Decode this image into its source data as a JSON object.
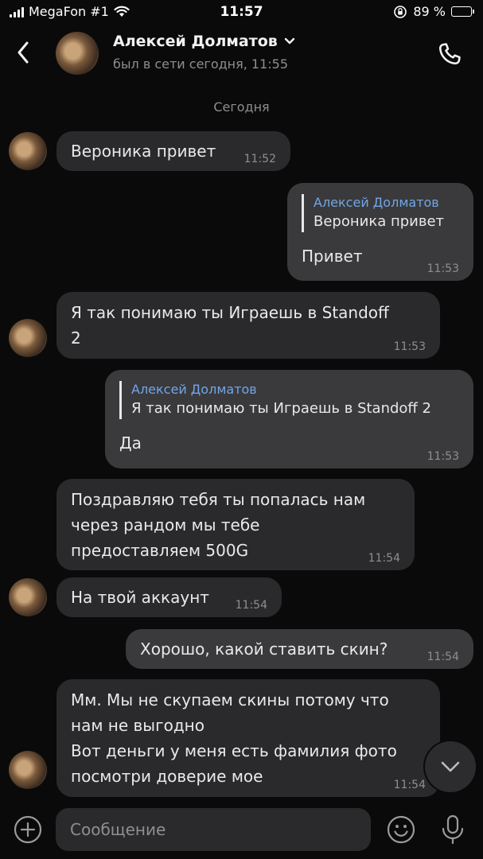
{
  "status_bar": {
    "carrier": "MegaFon #1",
    "time": "11:57",
    "battery": "89 %",
    "battery_level": 0.89
  },
  "header": {
    "contact_name": "Алексей Долматов",
    "last_seen": "был в сети сегодня, 11:55"
  },
  "date_separator": "Сегодня",
  "messages": [
    {
      "direction": "in",
      "text": "Вероника привет",
      "time": "11:52"
    },
    {
      "direction": "out",
      "reply_author": "Алексей Долматов",
      "reply_text": "Вероника привет",
      "text": "Привет",
      "time": "11:53"
    },
    {
      "direction": "in",
      "text": "Я так понимаю ты Играешь в Standoff\n2",
      "time": "11:53"
    },
    {
      "direction": "out",
      "reply_author": "Алексей Долматов",
      "reply_text": "Я так понимаю ты Играешь в Standoff 2",
      "text": "Да",
      "time": "11:53"
    },
    {
      "direction": "in",
      "text": "Поздравляю тебя ты попалась нам\nчерез рандом мы тебе\nпредоставляем 500G",
      "time": "11:54"
    },
    {
      "direction": "in",
      "text": "На твой аккаунт",
      "time": "11:54"
    },
    {
      "direction": "out",
      "text": "Хорошо, какой ставить скин?",
      "time": "11:54"
    },
    {
      "direction": "in",
      "text": "Мм. Мы не скупаем скины потому что\nнам не выгодно\nВот деньги у меня есть фамилия фото\nпосмотри доверие мое",
      "time": "11:54"
    }
  ],
  "composer": {
    "placeholder": "Сообщение"
  },
  "icons": {
    "back": "chevron-left-icon",
    "dropdown": "chevron-down-icon",
    "call": "phone-icon",
    "scroll_down": "chevron-down-icon",
    "attach": "plus-circle-icon",
    "emoji": "smile-icon",
    "mic": "microphone-icon"
  },
  "colors": {
    "background": "#0a0a0a",
    "incoming_bubble": "#2a2a2c",
    "outgoing_bubble": "#3a3a3c",
    "reply_author": "#71a6e6"
  }
}
